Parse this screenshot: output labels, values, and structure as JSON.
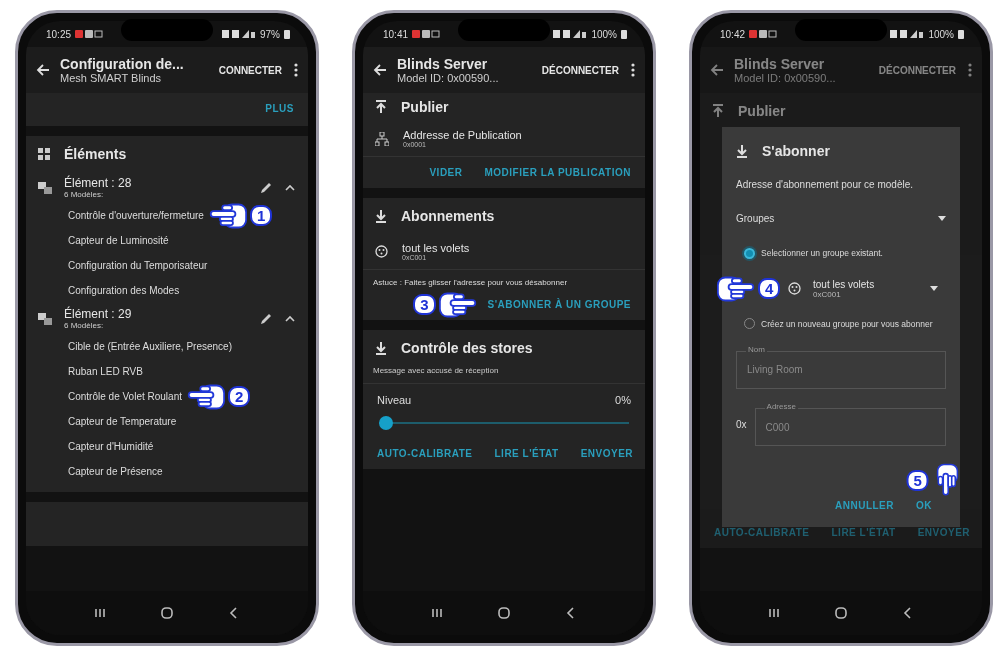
{
  "phones": [
    {
      "kind": "elements",
      "status": {
        "time": "10:25",
        "battery": "97%"
      },
      "app_bar": {
        "title": "Configuration de...",
        "subtitle": "Mesh SMART Blinds",
        "action": "CONNECTER"
      },
      "more_button": "PLUS",
      "elements_card": {
        "title": "Éléments",
        "elements": [
          {
            "title": "Élément : 28",
            "subtitle": "6 Modèles:",
            "expanded": true,
            "models": [
              {
                "name": "Contrôle d'ouverture/fermeture",
                "pointer": {
                  "step": "1"
                }
              },
              {
                "name": "Capteur de Luminosité"
              },
              {
                "name": "Configuration du Temporisateur"
              },
              {
                "name": "Configuration des Modes"
              }
            ]
          },
          {
            "title": "Élément : 29",
            "subtitle": "6 Modèles:",
            "expanded": true,
            "models": [
              {
                "name": "Cible de (Entrée Auxiliere, Presence)"
              },
              {
                "name": "Ruban LED RVB"
              },
              {
                "name": "Contrôle de Volet Roulant",
                "pointer": {
                  "step": "2"
                }
              },
              {
                "name": "Capteur de Temperature"
              },
              {
                "name": "Capteur d'Humidité"
              },
              {
                "name": "Capteur de Présence"
              }
            ]
          }
        ]
      }
    },
    {
      "kind": "model",
      "status": {
        "time": "10:41",
        "battery": "100%"
      },
      "app_bar": {
        "title": "Blinds Server",
        "subtitle": "Model ID: 0x00590...",
        "action": "DÉCONNECTER"
      },
      "publish": {
        "title": "Publier",
        "address_label": "Addresse de Publication",
        "address": "0x0001",
        "buttons": [
          "VIDER",
          "MODIFIER LA PUBLICATION"
        ]
      },
      "subscriptions": {
        "title": "Abonnements",
        "items": [
          {
            "name": "tout les volets",
            "address": "0xC001"
          }
        ],
        "hint": "Astuce : Faites glisser l'adresse pour vous désabonner",
        "button": "S'ABONNER À UN GROUPE",
        "pointer": {
          "step": "3"
        }
      },
      "control": {
        "title": "Contrôle des stores",
        "note": "Message avec accusé de réception",
        "level_label": "Niveau",
        "reading": "0%",
        "level": 0,
        "buttons": [
          "AUTO-CALIBRATE",
          "LIRE L'ÉTAT",
          "ENVOYER"
        ]
      }
    },
    {
      "kind": "dialog",
      "status": {
        "time": "10:42",
        "battery": "100%"
      },
      "app_bar": {
        "title": "Blinds Server",
        "subtitle": "Model ID: 0x00590...",
        "action": "DÉCONNECTER"
      },
      "background_section": "Publier",
      "background_buttons": [
        "AUTO-CALIBRATE",
        "LIRE L'ÉTAT",
        "ENVOYER"
      ],
      "dialog": {
        "title": "S'abonner",
        "text": "Adresse d'abonnement pour ce modèle.",
        "dropdown": "Groupes",
        "options": [
          {
            "label": "Selectionner un groupe existant.",
            "selected": true
          },
          {
            "label": "Créez un nouveau groupe pour vous abonner",
            "selected": false
          }
        ],
        "group": {
          "name": "tout les volets",
          "address": "0xC001",
          "pointer": {
            "step": "4"
          }
        },
        "name_field": {
          "label": "Nom",
          "placeholder": "Living Room"
        },
        "address_field": {
          "prefix": "0x",
          "label": "Adresse",
          "placeholder": "C000"
        },
        "buttons": [
          {
            "label": "ANNULLER"
          },
          {
            "label": "OK",
            "pointer": {
              "step": "5"
            }
          }
        ]
      }
    }
  ]
}
